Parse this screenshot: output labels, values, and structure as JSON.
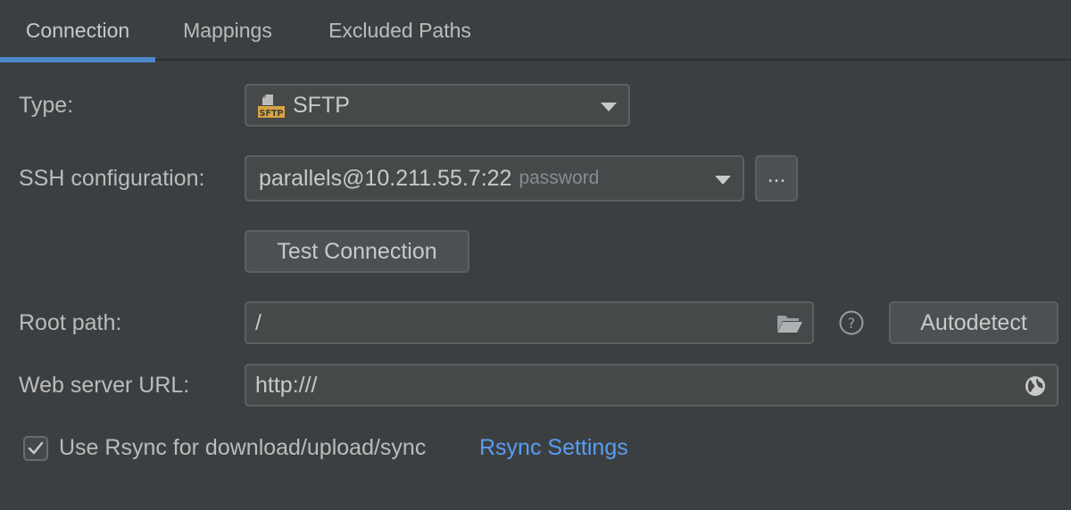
{
  "tabs": [
    {
      "label": "Connection",
      "active": true
    },
    {
      "label": "Mappings",
      "active": false
    },
    {
      "label": "Excluded Paths",
      "active": false
    }
  ],
  "form": {
    "type": {
      "label": "Type:",
      "value": "SFTP",
      "icon": "sftp-icon"
    },
    "ssh": {
      "label": "SSH configuration:",
      "value": "parallels@10.211.55.7:22",
      "hint": "password",
      "browse_label": "..."
    },
    "test_connection_label": "Test Connection",
    "root_path": {
      "label": "Root path:",
      "value": "/",
      "autodetect_label": "Autodetect"
    },
    "web_server": {
      "label": "Web server URL:",
      "value": "http:///"
    },
    "rsync": {
      "checked": true,
      "label": "Use Rsync for download/upload/sync",
      "settings_link": "Rsync Settings"
    }
  },
  "colors": {
    "background": "#3c3f41",
    "accent": "#4a88c7",
    "link": "#589df6",
    "sftp_icon": "#d9a441"
  }
}
